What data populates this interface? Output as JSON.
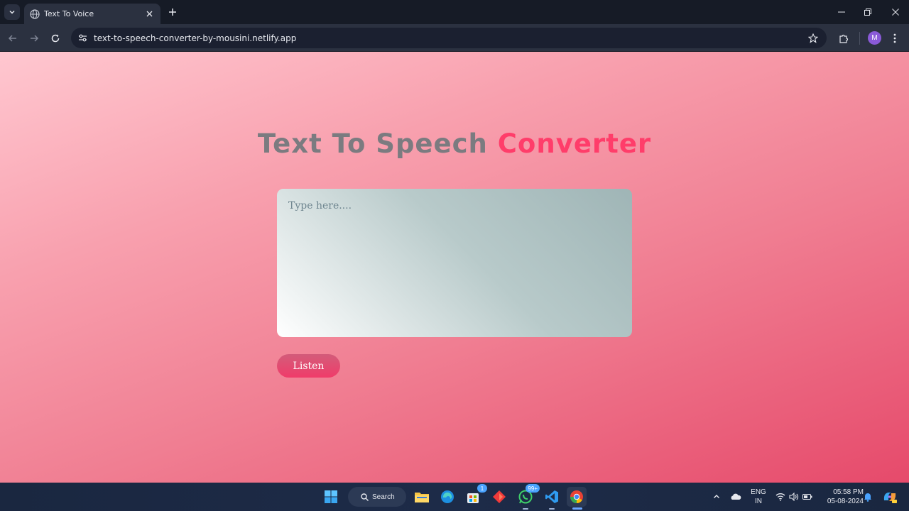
{
  "browser": {
    "tab_title": "Text To Voice",
    "url": "text-to-speech-converter-by-mousini.netlify.app",
    "profile_initial": "M"
  },
  "page": {
    "heading_part1": "Text To Speech",
    "heading_part2": "Converter",
    "textarea_placeholder": "Type here....",
    "textarea_value": "",
    "listen_button": "Listen"
  },
  "taskbar": {
    "search_label": "Search",
    "store_badge": "1",
    "whatsapp_badge": "99+",
    "language_line1": "ENG",
    "language_line2": "IN",
    "time": "05:58 PM",
    "date": "05-08-2024"
  },
  "colors": {
    "heading_gray": "#7b7b80",
    "heading_pink": "#ff3d6a",
    "accent_button": "#f03c6a"
  }
}
